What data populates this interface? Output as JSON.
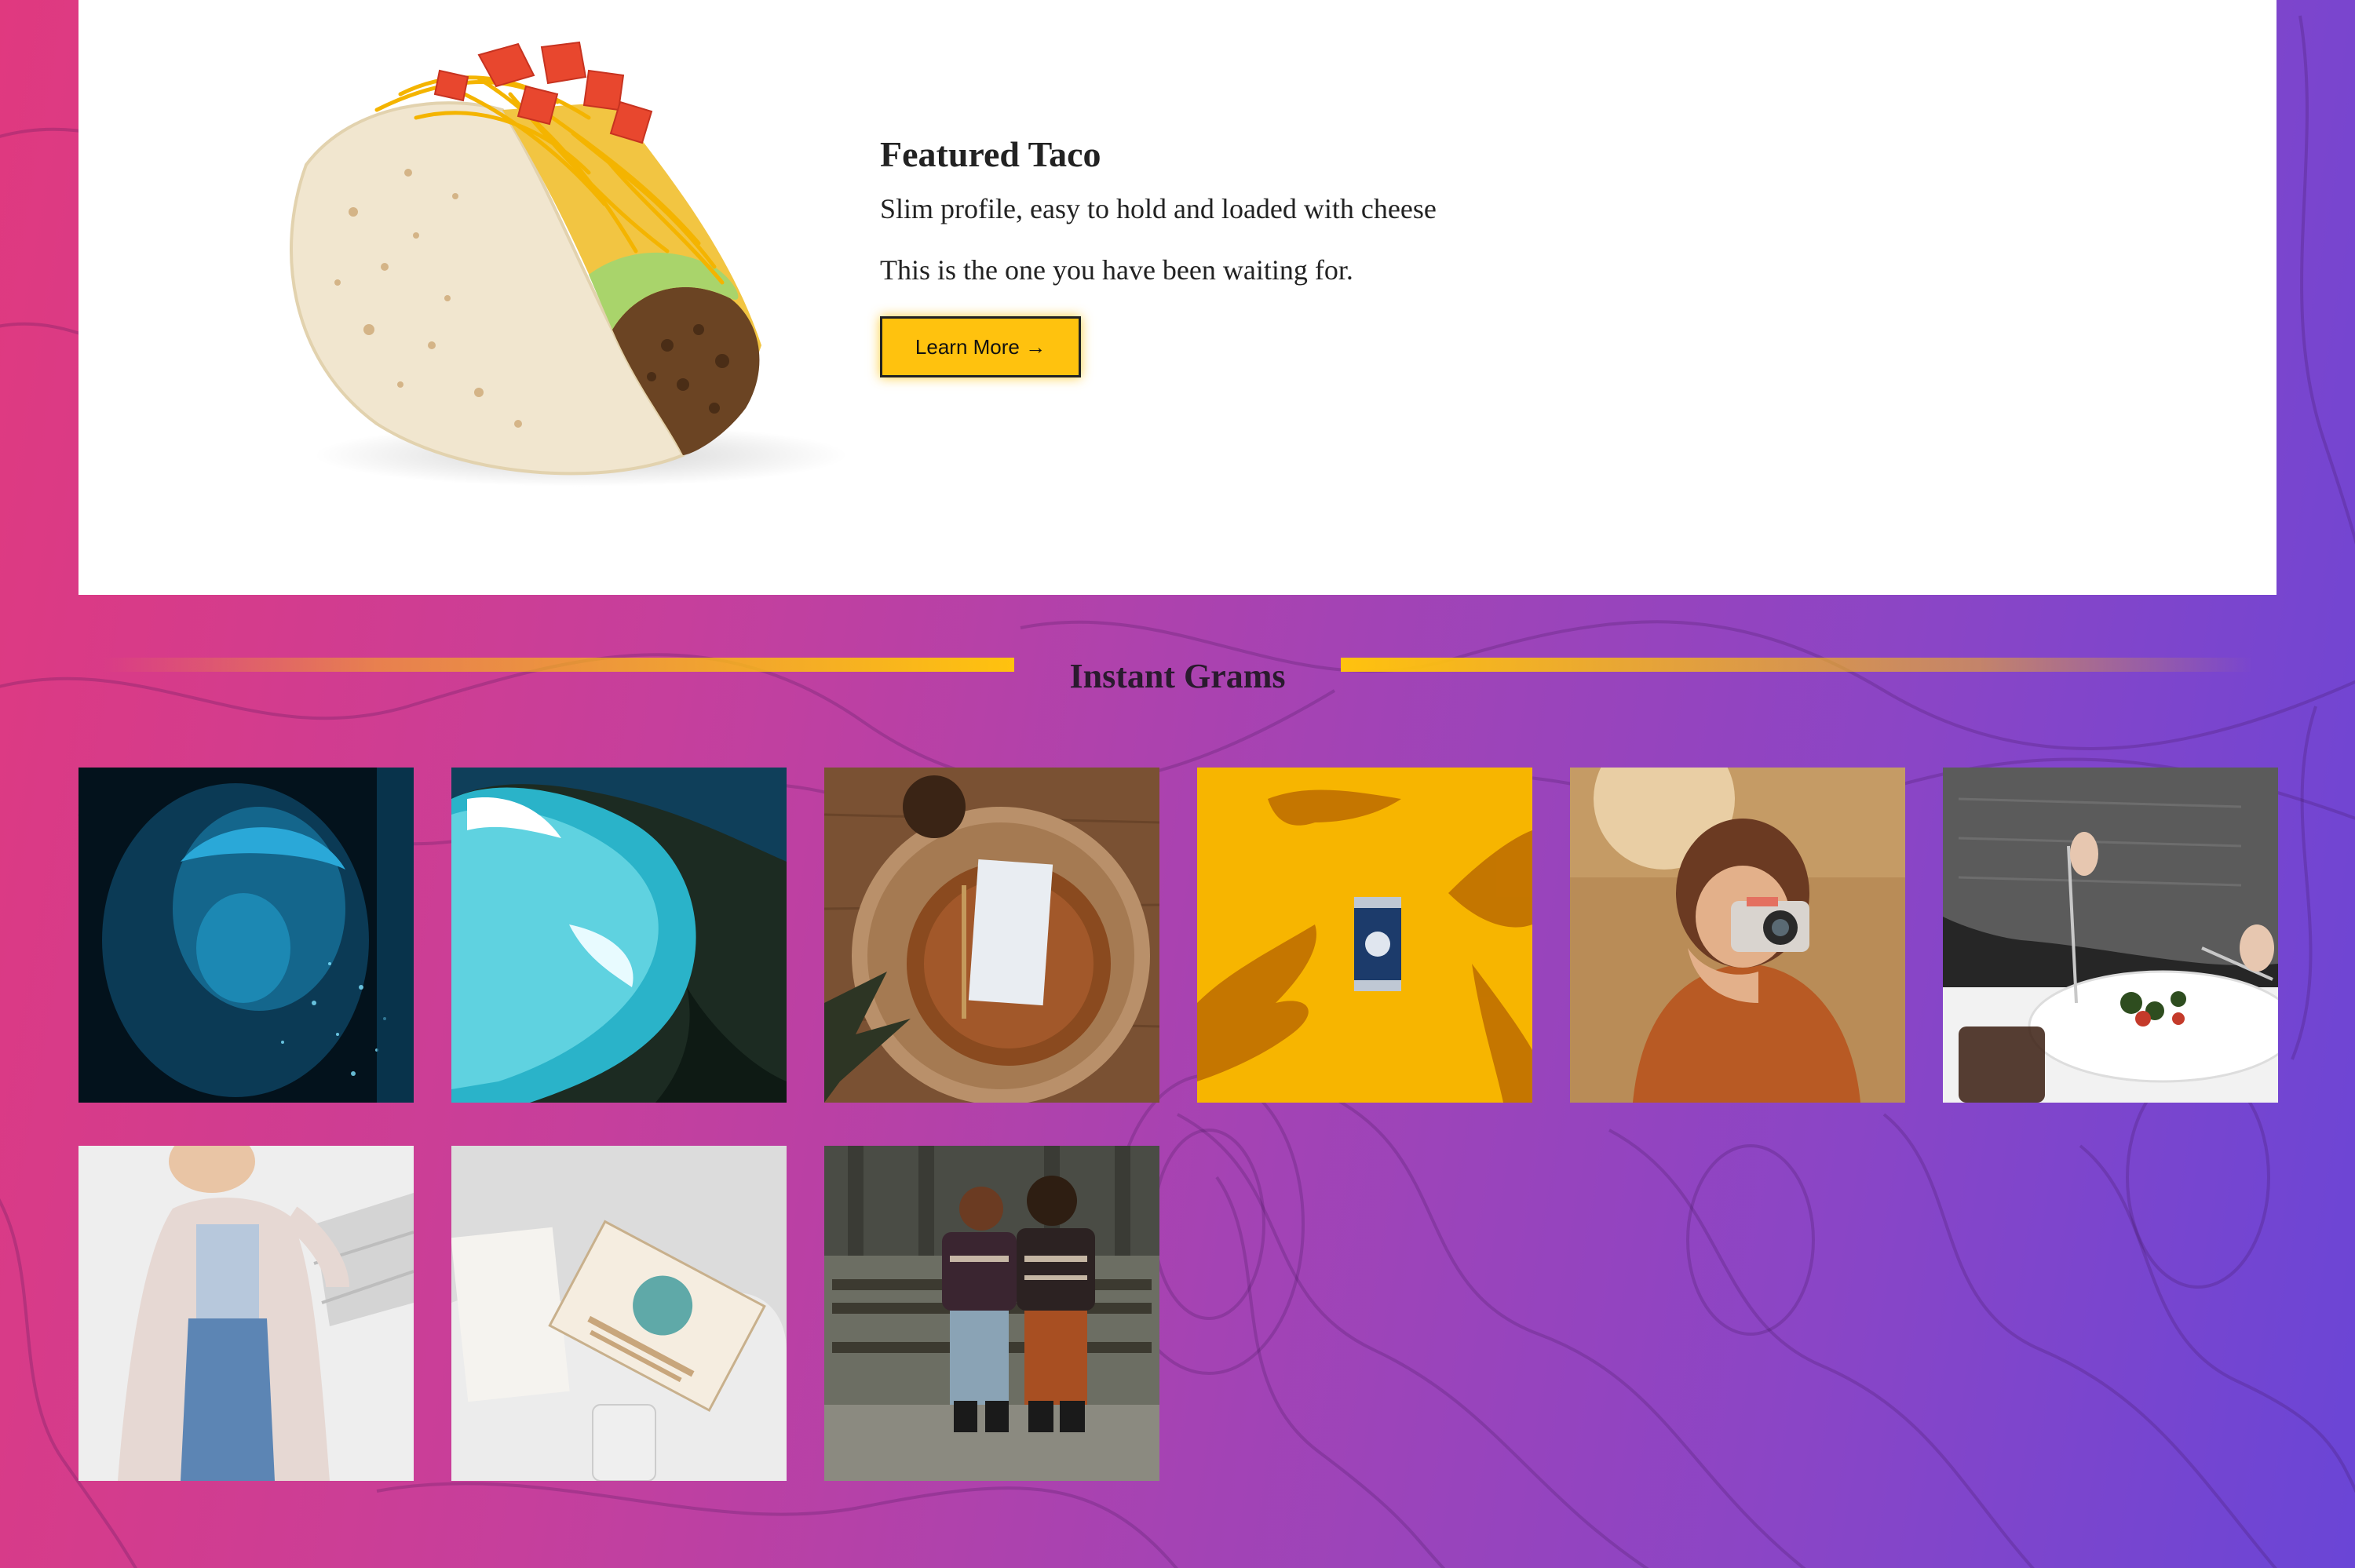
{
  "featured": {
    "title": "Featured Taco",
    "line1": "Slim profile, easy to hold and loaded with cheese",
    "line2": "This is the one you have been waiting for.",
    "button_label": "Learn More →",
    "image": "taco-photo"
  },
  "grams": {
    "title": "Instant Grams",
    "items": [
      {
        "image": "person-blue-neon-photo"
      },
      {
        "image": "aerial-turquoise-coast-photo"
      },
      {
        "image": "table-setting-photo"
      },
      {
        "image": "soda-can-yellow-photo"
      },
      {
        "image": "girl-with-camera-photo"
      },
      {
        "image": "plated-salad-photo"
      },
      {
        "image": "woman-in-coat-photo"
      },
      {
        "image": "product-boxes-photo"
      },
      {
        "image": "couple-on-bench-photo"
      }
    ]
  },
  "colors": {
    "accent": "#ffc20e",
    "gradient_start": "#e0397f",
    "gradient_end": "#6a45d6"
  }
}
